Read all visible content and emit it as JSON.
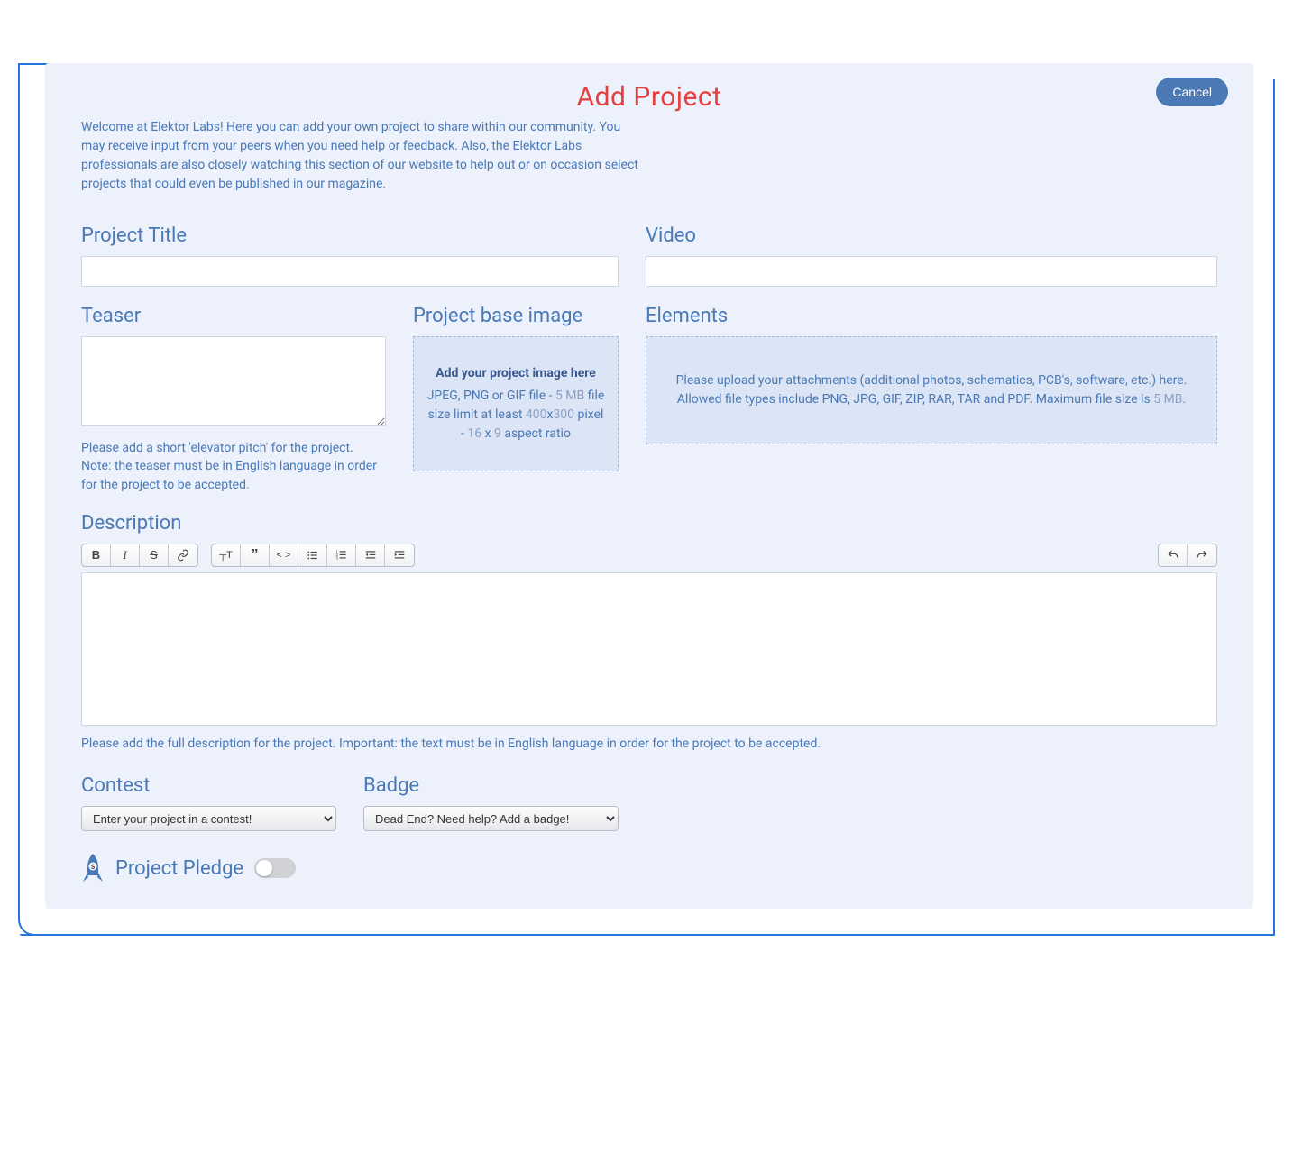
{
  "page": {
    "title": "Add Project",
    "cancel_label": "Cancel",
    "intro": "Welcome at Elektor Labs! Here you can add your own project to share within our community. You may receive input from your peers when you need help or feedback. Also, the Elektor Labs professionals are also closely watching this section of our website to help out or on occasion select projects that could even be published in our magazine."
  },
  "project_title": {
    "label": "Project Title",
    "value": ""
  },
  "video": {
    "label": "Video",
    "value": ""
  },
  "teaser": {
    "label": "Teaser",
    "value": "",
    "hint": "Please add a short 'elevator pitch' for the project. Note: the teaser must be in English language in order for the project to be accepted."
  },
  "base_image": {
    "label": "Project base image",
    "dropzone_title": "Add your project image here",
    "dropzone_line_prefix": "JPEG, PNG or GIF file - ",
    "dropzone_size": "5 MB",
    "dropzone_line_mid": " file size limit at least ",
    "dropzone_dim_w": "400",
    "dropzone_x": "x",
    "dropzone_dim_h": "300",
    "dropzone_line_mid2": " pixel - ",
    "dropzone_ratio_w": "16",
    "dropzone_x2": " x ",
    "dropzone_ratio_h": "9",
    "dropzone_line_end": " aspect ratio"
  },
  "elements": {
    "label": "Elements",
    "dropzone_text_pre": "Please upload your attachments (additional photos, schematics, PCB's, software, etc.) here. Allowed file types include PNG, JPG, GIF, ZIP, RAR, TAR and PDF. Maximum file size is ",
    "dropzone_size": "5 MB",
    "dropzone_text_post": "."
  },
  "description": {
    "label": "Description",
    "hint": "Please add the full description for the project. Important: the text must be in English language in order for the project to be accepted."
  },
  "contest": {
    "label": "Contest",
    "selected": "Enter your project in a contest!"
  },
  "badge": {
    "label": "Badge",
    "selected": "Dead End? Need help? Add a badge!"
  },
  "pledge": {
    "label": "Project Pledge",
    "enabled": false
  }
}
